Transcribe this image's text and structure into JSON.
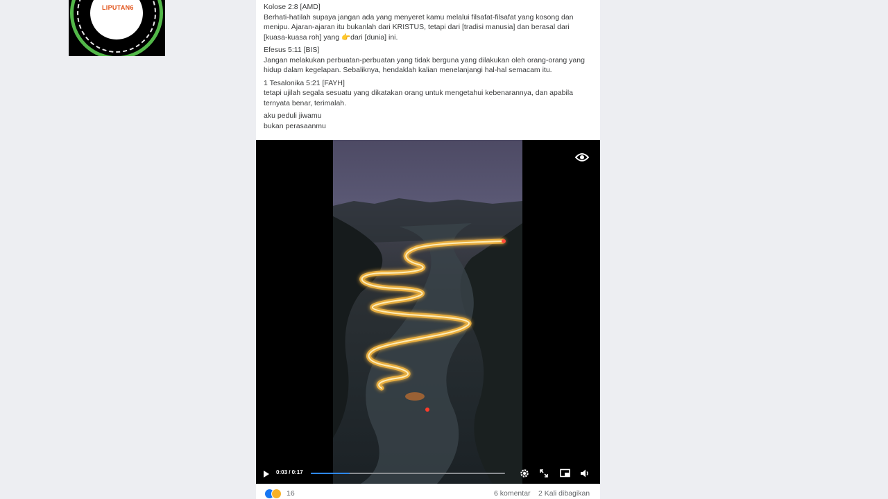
{
  "logo": {
    "brand_text": "LIPUTAN6"
  },
  "post": {
    "paragraphs": [
      {
        "ref": "Kolose 2:8 [AMD]",
        "body": "Berhati-hatilah supaya jangan ada yang menyeret kamu melalui filsafat-filsafat yang kosong dan menipu. Ajaran-ajaran itu bukanlah dari KRISTUS, tetapi dari [tradisi manusia] dan berasal dari [kuasa-kuasa roh] yang 👉dari [dunia] ini."
      },
      {
        "ref": "Efesus 5:11 [BIS]",
        "body": "Jangan melakukan perbuatan-perbuatan yang tidak berguna yang dilakukan oleh orang-orang yang hidup dalam kegelapan. Sebaliknya, hendaklah kalian menelanjangi hal-hal semacam itu."
      },
      {
        "ref": "1 Tesalonika 5:21 [FAYH]",
        "body": "tetapi ujilah segala sesuatu yang dikatakan orang untuk mengetahui kebenarannya, dan apabila ternyata benar, terimalah."
      }
    ],
    "closing_line1": "aku peduli jiwamu",
    "closing_line2": "bukan perasaanmu"
  },
  "video": {
    "time": "0:03 / 0:17",
    "progress_fraction": 0.2,
    "icons": [
      "eye-icon",
      "play-icon",
      "settings-icon",
      "fullscreen-icon",
      "pip-icon",
      "volume-icon"
    ]
  },
  "footer": {
    "reactions_count": "16",
    "comments": "6 komentar",
    "shares": "2 Kali dibagikan",
    "reaction_icons": [
      "like-icon",
      "haha-icon"
    ]
  },
  "colors": {
    "page_bg": "#edeef2",
    "progress_fill": "#2d88ff",
    "logo_ring": "#53b849",
    "logo_text": "#e2541b"
  }
}
